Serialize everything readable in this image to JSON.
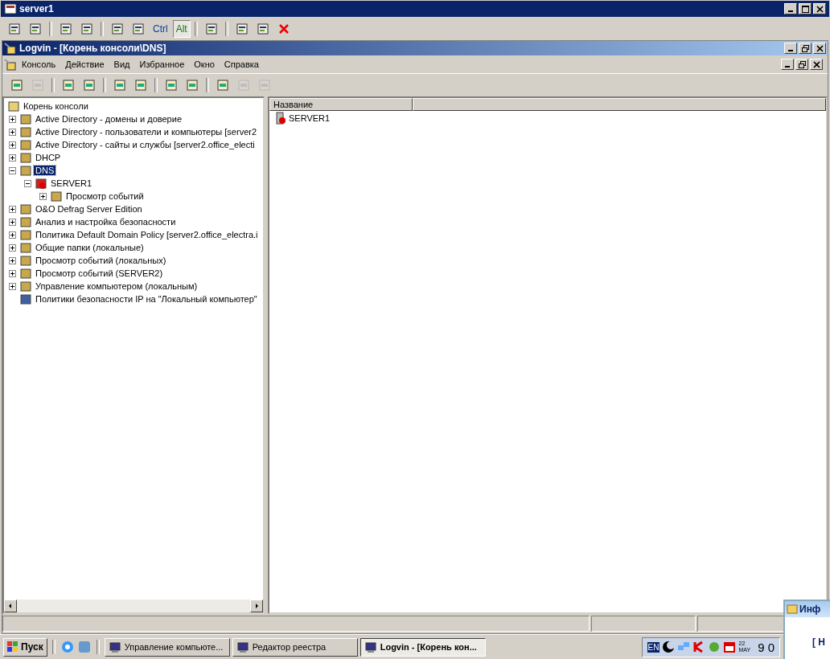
{
  "vnc_window": {
    "title": "server1",
    "toolbar": [
      {
        "kind": "icon"
      },
      {
        "kind": "icon"
      },
      {
        "kind": "sep"
      },
      {
        "kind": "icon"
      },
      {
        "kind": "icon"
      },
      {
        "kind": "sep"
      },
      {
        "kind": "icon"
      },
      {
        "kind": "icon"
      },
      {
        "kind": "text",
        "label": "Ctrl",
        "selected": false
      },
      {
        "kind": "text",
        "label": "Alt",
        "selected": true
      },
      {
        "kind": "sep"
      },
      {
        "kind": "icon"
      },
      {
        "kind": "sep"
      },
      {
        "kind": "icon"
      },
      {
        "kind": "icon"
      },
      {
        "kind": "close"
      }
    ]
  },
  "console_window": {
    "title": "Logvin - [Корень консоли\\DNS]",
    "menu": [
      "Консоль",
      "Действие",
      "Вид",
      "Избранное",
      "Окно",
      "Справка"
    ],
    "toolbar": [
      {
        "kind": "icon",
        "disabled": false
      },
      {
        "kind": "icon",
        "disabled": true
      },
      {
        "kind": "sep"
      },
      {
        "kind": "icon",
        "disabled": false
      },
      {
        "kind": "icon",
        "disabled": false
      },
      {
        "kind": "sep"
      },
      {
        "kind": "icon",
        "disabled": false
      },
      {
        "kind": "icon",
        "disabled": false
      },
      {
        "kind": "sep"
      },
      {
        "kind": "icon",
        "disabled": false
      },
      {
        "kind": "icon",
        "disabled": false
      },
      {
        "kind": "sep"
      },
      {
        "kind": "icon",
        "disabled": false
      },
      {
        "kind": "icon",
        "disabled": true
      },
      {
        "kind": "icon",
        "disabled": true
      }
    ],
    "tree": {
      "label": "Корень консоли",
      "kind": "root",
      "selected": false,
      "children": [
        {
          "label": "Active Directory - домены и доверие",
          "kind": "node",
          "expanded": false,
          "selected": false
        },
        {
          "label": "Active Directory - пользователи и компьютеры [server2",
          "kind": "node",
          "expanded": false,
          "selected": false
        },
        {
          "label": "Active Directory - сайты и службы [server2.office_electi",
          "kind": "node",
          "expanded": false,
          "selected": false
        },
        {
          "label": "DHCP",
          "kind": "node",
          "expanded": false,
          "selected": false
        },
        {
          "label": "DNS",
          "kind": "node",
          "expanded": true,
          "selected": true,
          "children": [
            {
              "label": "SERVER1",
              "kind": "error",
              "expanded": true,
              "selected": false,
              "children": [
                {
                  "label": "Просмотр событий",
                  "kind": "node",
                  "expanded": false,
                  "selected": false
                }
              ]
            }
          ]
        },
        {
          "label": "O&O Defrag Server Edition",
          "kind": "node",
          "expanded": false,
          "selected": false
        },
        {
          "label": "Анализ и настройка безопасности",
          "kind": "node",
          "expanded": false,
          "selected": false
        },
        {
          "label": "Политика Default Domain Policy [server2.office_electra.i",
          "kind": "node",
          "expanded": false,
          "selected": false
        },
        {
          "label": "Общие папки (локальные)",
          "kind": "node",
          "expanded": false,
          "selected": false
        },
        {
          "label": "Просмотр событий (локальных)",
          "kind": "node",
          "expanded": false,
          "selected": false
        },
        {
          "label": "Просмотр событий (SERVER2)",
          "kind": "node",
          "expanded": false,
          "selected": false
        },
        {
          "label": "Управление компьютером (локальным)",
          "kind": "node",
          "expanded": false,
          "selected": false
        },
        {
          "label": "Политики безопасности IP на \"Локальный компьютер\"",
          "kind": "leaf",
          "selected": false
        }
      ]
    },
    "list": {
      "columns": [
        "Название"
      ],
      "rows": [
        {
          "name": "SERVER1",
          "kind": "error"
        }
      ]
    }
  },
  "taskbar": {
    "start": "Пуск",
    "tasks": [
      {
        "label": "Управление компьюте...",
        "selected": false
      },
      {
        "label": "Редактор реестра",
        "selected": false
      },
      {
        "label": "Logvin - [Корень кон...",
        "selected": true
      }
    ],
    "tray": {
      "language": "EN",
      "date_day": "22",
      "date_month": "MAY",
      "clock": "9 0"
    }
  },
  "notification": {
    "title": "Инф",
    "text": "[ Н"
  }
}
